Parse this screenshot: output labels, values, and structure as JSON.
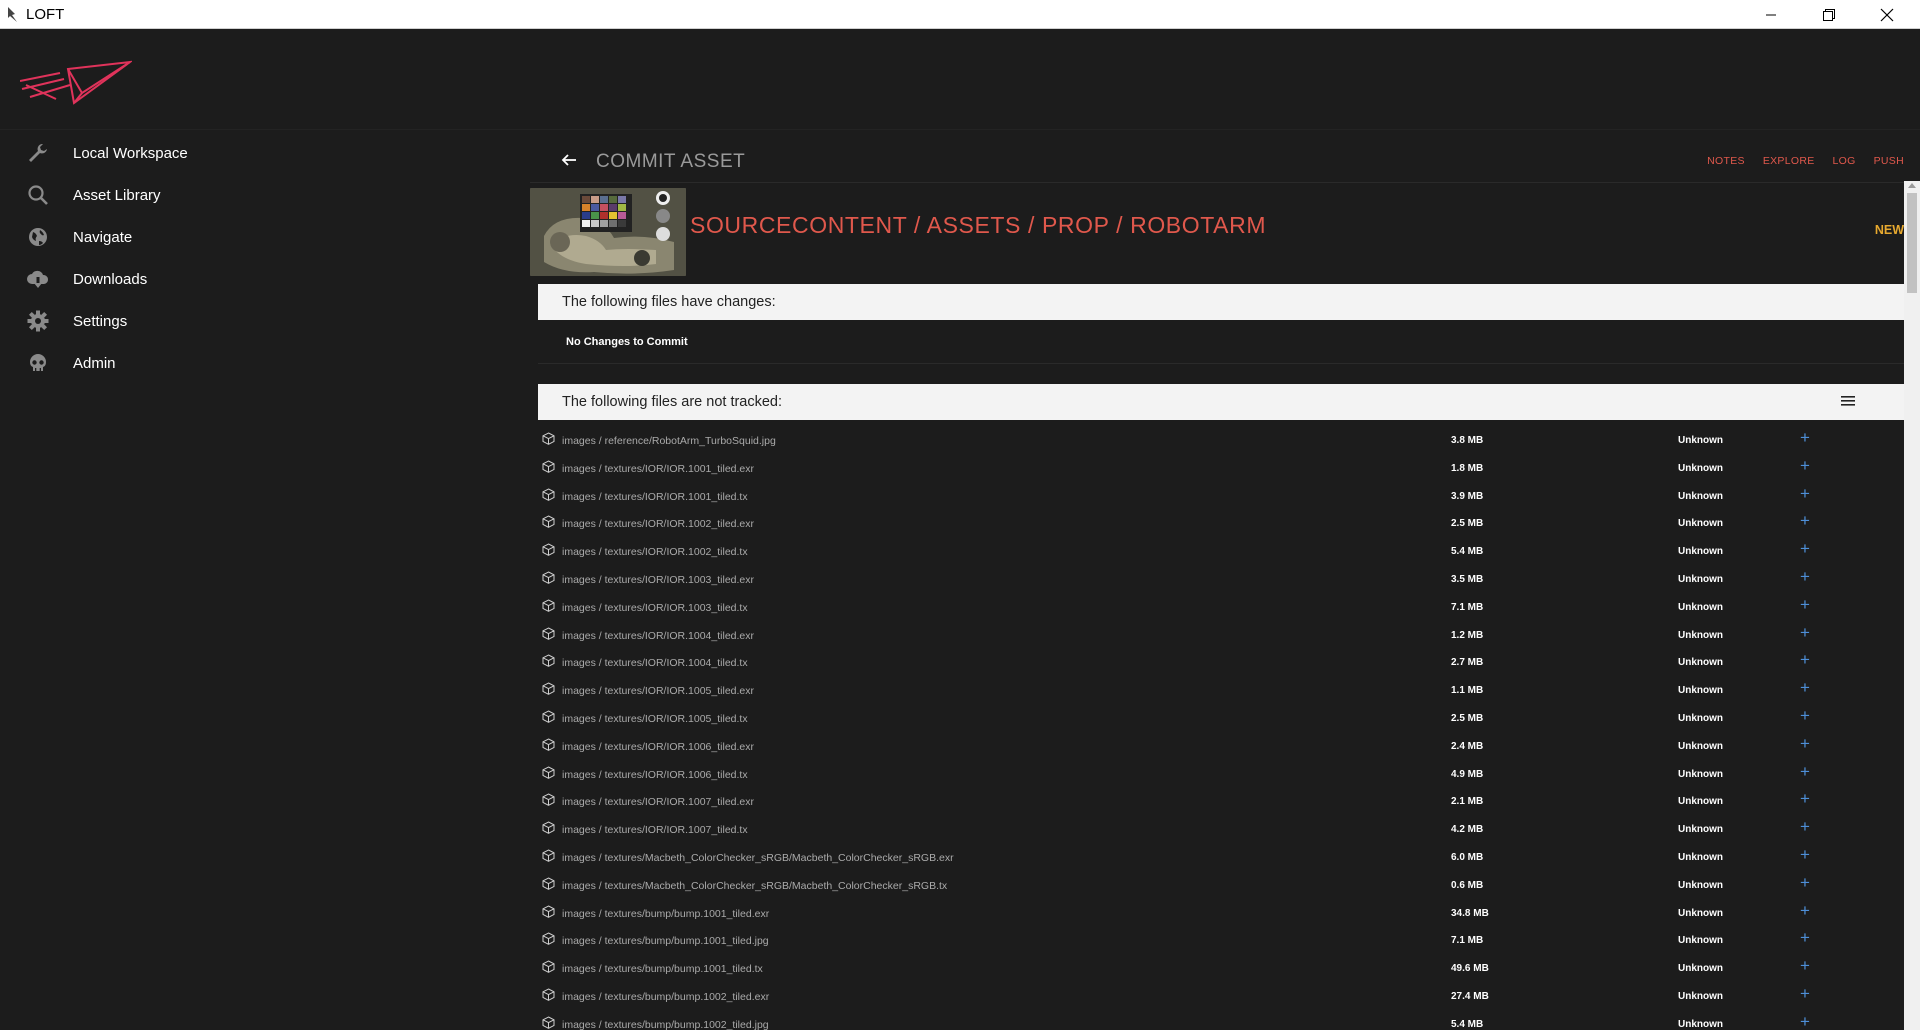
{
  "window": {
    "title": "LOFT",
    "icons": {
      "app": "loft-app-icon",
      "minimize": "minimize-icon",
      "restore": "restore-icon",
      "close": "close-icon"
    }
  },
  "sidebar": {
    "logo": "paper-plane-logo",
    "items": [
      {
        "label": "Local Workspace",
        "icon": "wrench-icon"
      },
      {
        "label": "Asset Library",
        "icon": "search-icon"
      },
      {
        "label": "Navigate",
        "icon": "globe-icon"
      },
      {
        "label": "Downloads",
        "icon": "cloud-download-icon"
      },
      {
        "label": "Settings",
        "icon": "gear-icon"
      },
      {
        "label": "Admin",
        "icon": "skull-icon"
      }
    ]
  },
  "header": {
    "title": "COMMIT ASSET",
    "links": [
      "NOTES",
      "EXPLORE",
      "LOG",
      "PUSH"
    ]
  },
  "asset": {
    "path": "SOURCECONTENT / ASSETS / PROP / ROBOTARM",
    "status": "NEW"
  },
  "changes": {
    "header": "The following files have changes:",
    "empty_text": "No Changes to Commit"
  },
  "untracked": {
    "header": "The following files are not tracked:",
    "rows": [
      {
        "path": "images / reference/RobotArm_TurboSquid.jpg",
        "size": "3.8 MB",
        "status": "Unknown"
      },
      {
        "path": "images / textures/IOR/IOR.1001_tiled.exr",
        "size": "1.8 MB",
        "status": "Unknown"
      },
      {
        "path": "images / textures/IOR/IOR.1001_tiled.tx",
        "size": "3.9 MB",
        "status": "Unknown"
      },
      {
        "path": "images / textures/IOR/IOR.1002_tiled.exr",
        "size": "2.5 MB",
        "status": "Unknown"
      },
      {
        "path": "images / textures/IOR/IOR.1002_tiled.tx",
        "size": "5.4 MB",
        "status": "Unknown"
      },
      {
        "path": "images / textures/IOR/IOR.1003_tiled.exr",
        "size": "3.5 MB",
        "status": "Unknown"
      },
      {
        "path": "images / textures/IOR/IOR.1003_tiled.tx",
        "size": "7.1 MB",
        "status": "Unknown"
      },
      {
        "path": "images / textures/IOR/IOR.1004_tiled.exr",
        "size": "1.2 MB",
        "status": "Unknown"
      },
      {
        "path": "images / textures/IOR/IOR.1004_tiled.tx",
        "size": "2.7 MB",
        "status": "Unknown"
      },
      {
        "path": "images / textures/IOR/IOR.1005_tiled.exr",
        "size": "1.1 MB",
        "status": "Unknown"
      },
      {
        "path": "images / textures/IOR/IOR.1005_tiled.tx",
        "size": "2.5 MB",
        "status": "Unknown"
      },
      {
        "path": "images / textures/IOR/IOR.1006_tiled.exr",
        "size": "2.4 MB",
        "status": "Unknown"
      },
      {
        "path": "images / textures/IOR/IOR.1006_tiled.tx",
        "size": "4.9 MB",
        "status": "Unknown"
      },
      {
        "path": "images / textures/IOR/IOR.1007_tiled.exr",
        "size": "2.1 MB",
        "status": "Unknown"
      },
      {
        "path": "images / textures/IOR/IOR.1007_tiled.tx",
        "size": "4.2 MB",
        "status": "Unknown"
      },
      {
        "path": "images / textures/Macbeth_ColorChecker_sRGB/Macbeth_ColorChecker_sRGB.exr",
        "size": "6.0 MB",
        "status": "Unknown"
      },
      {
        "path": "images / textures/Macbeth_ColorChecker_sRGB/Macbeth_ColorChecker_sRGB.tx",
        "size": "0.6 MB",
        "status": "Unknown"
      },
      {
        "path": "images / textures/bump/bump.1001_tiled.exr",
        "size": "34.8 MB",
        "status": "Unknown"
      },
      {
        "path": "images / textures/bump/bump.1001_tiled.jpg",
        "size": "7.1 MB",
        "status": "Unknown"
      },
      {
        "path": "images / textures/bump/bump.1001_tiled.tx",
        "size": "49.6 MB",
        "status": "Unknown"
      },
      {
        "path": "images / textures/bump/bump.1002_tiled.exr",
        "size": "27.4 MB",
        "status": "Unknown"
      },
      {
        "path": "images / textures/bump/bump.1002_tiled.jpg",
        "size": "5.4 MB",
        "status": "Unknown"
      }
    ]
  },
  "colors": {
    "accent": "#e0584c",
    "status_new": "#e7a92f",
    "add": "#4e8fd8",
    "background": "#1c1c1c"
  }
}
